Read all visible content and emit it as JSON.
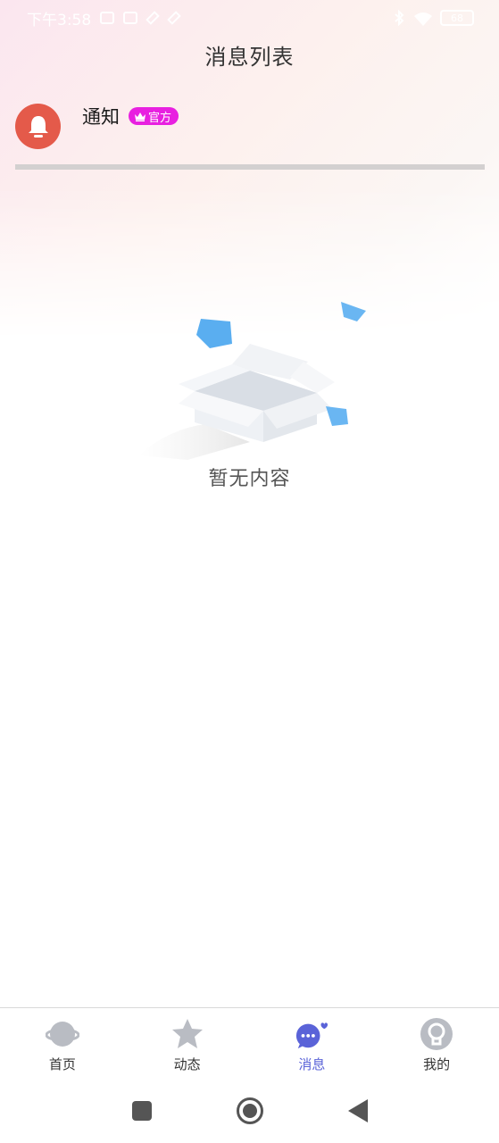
{
  "status_bar": {
    "time": "下午3:58",
    "battery": "68"
  },
  "header": {
    "title": "消息列表"
  },
  "notice": {
    "title": "通知",
    "badge": "官方",
    "icon": "bell-icon",
    "badge_icon": "crown-icon"
  },
  "empty_state": {
    "text": "暂无内容",
    "illustration": "empty-box-illustration"
  },
  "bottom_nav": {
    "items": [
      {
        "label": "首页",
        "icon": "planet-icon",
        "active": false
      },
      {
        "label": "动态",
        "icon": "star-icon",
        "active": false
      },
      {
        "label": "消息",
        "icon": "chat-bubble-icon",
        "active": true
      },
      {
        "label": "我的",
        "icon": "profile-icon",
        "active": false
      }
    ]
  },
  "colors": {
    "accent": "#5a63d8",
    "notice_avatar": "#e45a4a",
    "badge": "#e820e0"
  }
}
